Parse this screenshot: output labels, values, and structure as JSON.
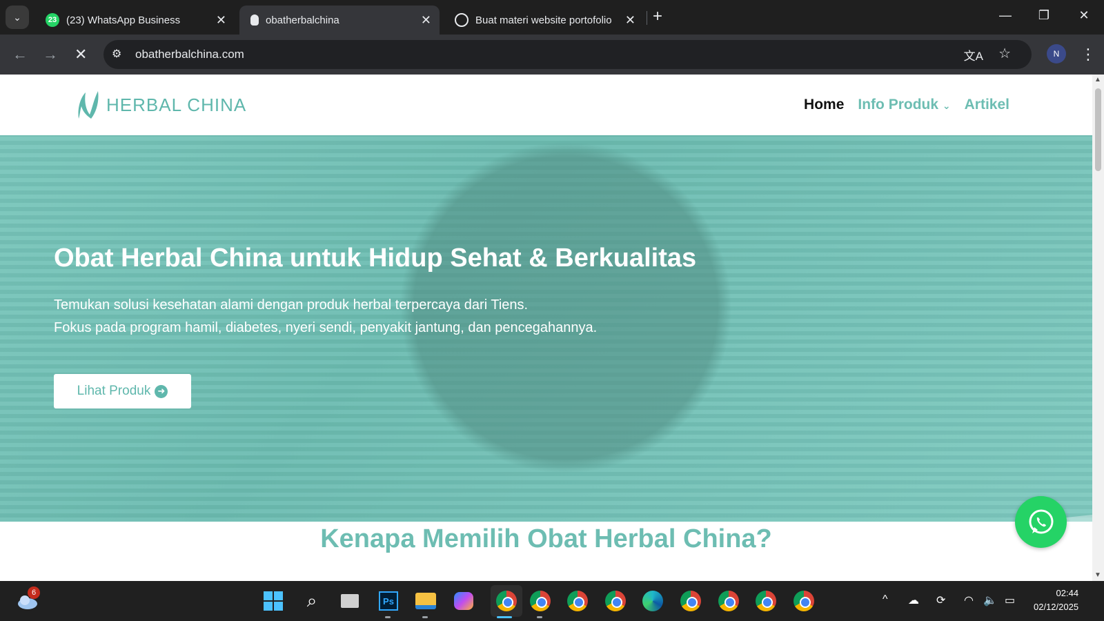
{
  "browser": {
    "tabs": [
      {
        "title": "(23) WhatsApp Business",
        "badge": "23"
      },
      {
        "title": "obatherbalchina"
      },
      {
        "title": "Buat materi website portofolio"
      }
    ],
    "url": "obatherbalchina.com"
  },
  "site": {
    "logo_text": "HERBAL CHINA",
    "nav": {
      "home": "Home",
      "info": "Info Produk",
      "artikel": "Artikel"
    },
    "hero": {
      "title": "Obat Herbal China untuk Hidup Sehat & Berkualitas",
      "line1": "Temukan solusi kesehatan alami dengan produk herbal terpercaya dari Tiens.",
      "line2": "Fokus pada program hamil, diabetes, nyeri sendi, penyakit jantung, dan pencegahannya.",
      "button": "Lihat Produk"
    },
    "section_title": "Kenapa Memilih Obat Herbal China?"
  },
  "taskbar": {
    "weather_badge": "6",
    "time": "02:44",
    "date": "02/12/2025"
  },
  "colors": {
    "brand": "#6dbdb2",
    "whatsapp": "#25d366"
  }
}
